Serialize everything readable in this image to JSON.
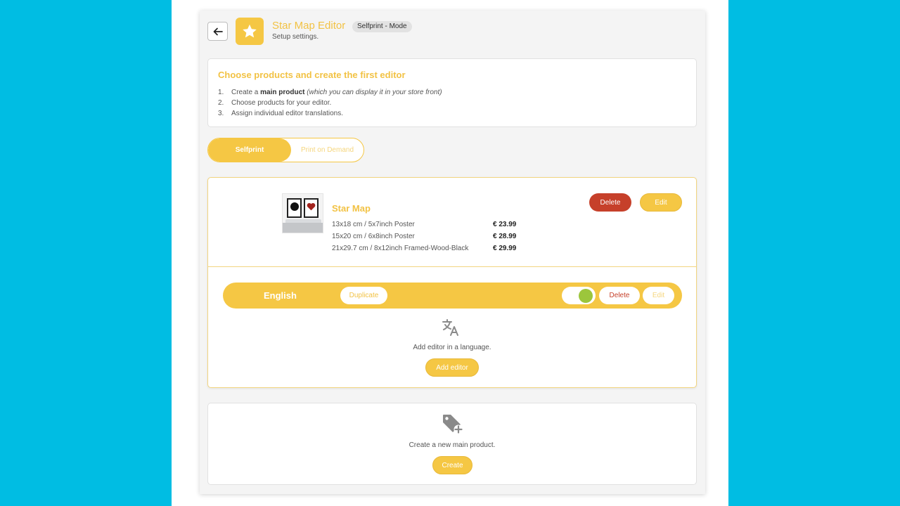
{
  "header": {
    "title": "Star Map Editor",
    "mode_badge": "Selfprint - Mode",
    "subtitle": "Setup settings."
  },
  "info": {
    "heading": "Choose products and create the first editor",
    "steps": [
      {
        "num": "1.",
        "pre": "Create a ",
        "bold": "main product",
        "italic": " (which you can display it in your store front)"
      },
      {
        "num": "2.",
        "text": "Choose products for your editor."
      },
      {
        "num": "3.",
        "text": "Assign individual editor translations."
      }
    ]
  },
  "mode_toggle": {
    "active": "Selfprint",
    "inactive": "Print on Demand"
  },
  "product": {
    "name": "Star Map",
    "delete_label": "Delete",
    "edit_label": "Edit",
    "variants": [
      {
        "name": "13x18 cm / 5x7inch Poster",
        "price": "€ 23.99"
      },
      {
        "name": "15x20 cm / 6x8inch Poster",
        "price": "€ 28.99"
      },
      {
        "name": "21x29.7 cm / 8x12inch Framed-Wood-Black",
        "price": "€ 29.99"
      }
    ],
    "language": {
      "name": "English",
      "duplicate_label": "Duplicate",
      "enabled": true,
      "delete_label": "Delete",
      "edit_label": "Edit"
    },
    "add_language_text": "Add editor in a language.",
    "add_editor_label": "Add editor"
  },
  "create": {
    "text": "Create a new main product.",
    "button_label": "Create"
  },
  "icons": {
    "back": "arrow-left-icon",
    "logo": "star-icon",
    "translate": "translate-icon",
    "new_product": "tag-plus-icon"
  },
  "colors": {
    "accent": "#f5c744",
    "danger": "#c6402a",
    "toggle_on": "#9cc63c",
    "background": "#00bde3"
  }
}
